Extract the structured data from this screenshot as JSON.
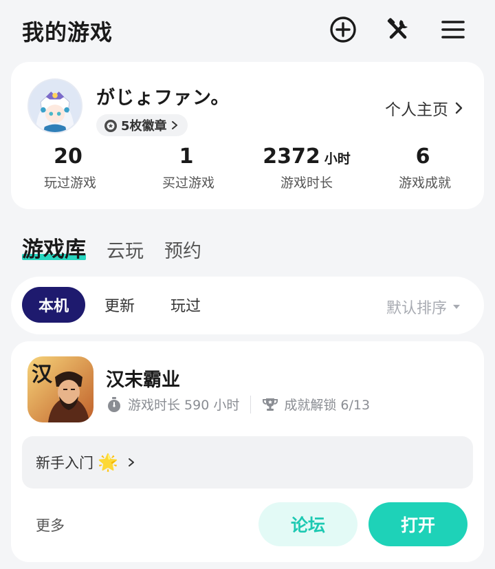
{
  "header": {
    "title": "我的游戏",
    "icons": [
      "add-circle-icon",
      "tools-icon",
      "menu-icon"
    ]
  },
  "profile": {
    "username": "がじょファン。",
    "badge": "5枚徽章",
    "home_link": "个人主页",
    "stats": [
      {
        "value": "20",
        "unit": "",
        "label": "玩过游戏"
      },
      {
        "value": "1",
        "unit": "",
        "label": "买过游戏"
      },
      {
        "value": "2372",
        "unit": "小时",
        "label": "游戏时长"
      },
      {
        "value": "6",
        "unit": "",
        "label": "游戏成就"
      }
    ]
  },
  "main_tabs": [
    {
      "label": "游戏库",
      "active": true
    },
    {
      "label": "云玩",
      "active": false
    },
    {
      "label": "预约",
      "active": false
    }
  ],
  "filters": {
    "pills": [
      {
        "label": "本机",
        "active": true
      },
      {
        "label": "更新",
        "active": false
      },
      {
        "label": "玩过",
        "active": false
      }
    ],
    "sort": "默认排序"
  },
  "game": {
    "title": "汉末霸业",
    "icon_char": "汉",
    "playtime": "游戏时长 590 小时",
    "achievements": "成就解锁 6/13",
    "guide": "新手入门",
    "guide_emoji": "🌟",
    "more": "更多",
    "forum": "论坛",
    "open": "打开"
  },
  "colors": {
    "accent": "#1ed2b8",
    "accent_light": "#e3faf6",
    "pill_active": "#1e1a6e",
    "background": "#f4f5f7"
  }
}
